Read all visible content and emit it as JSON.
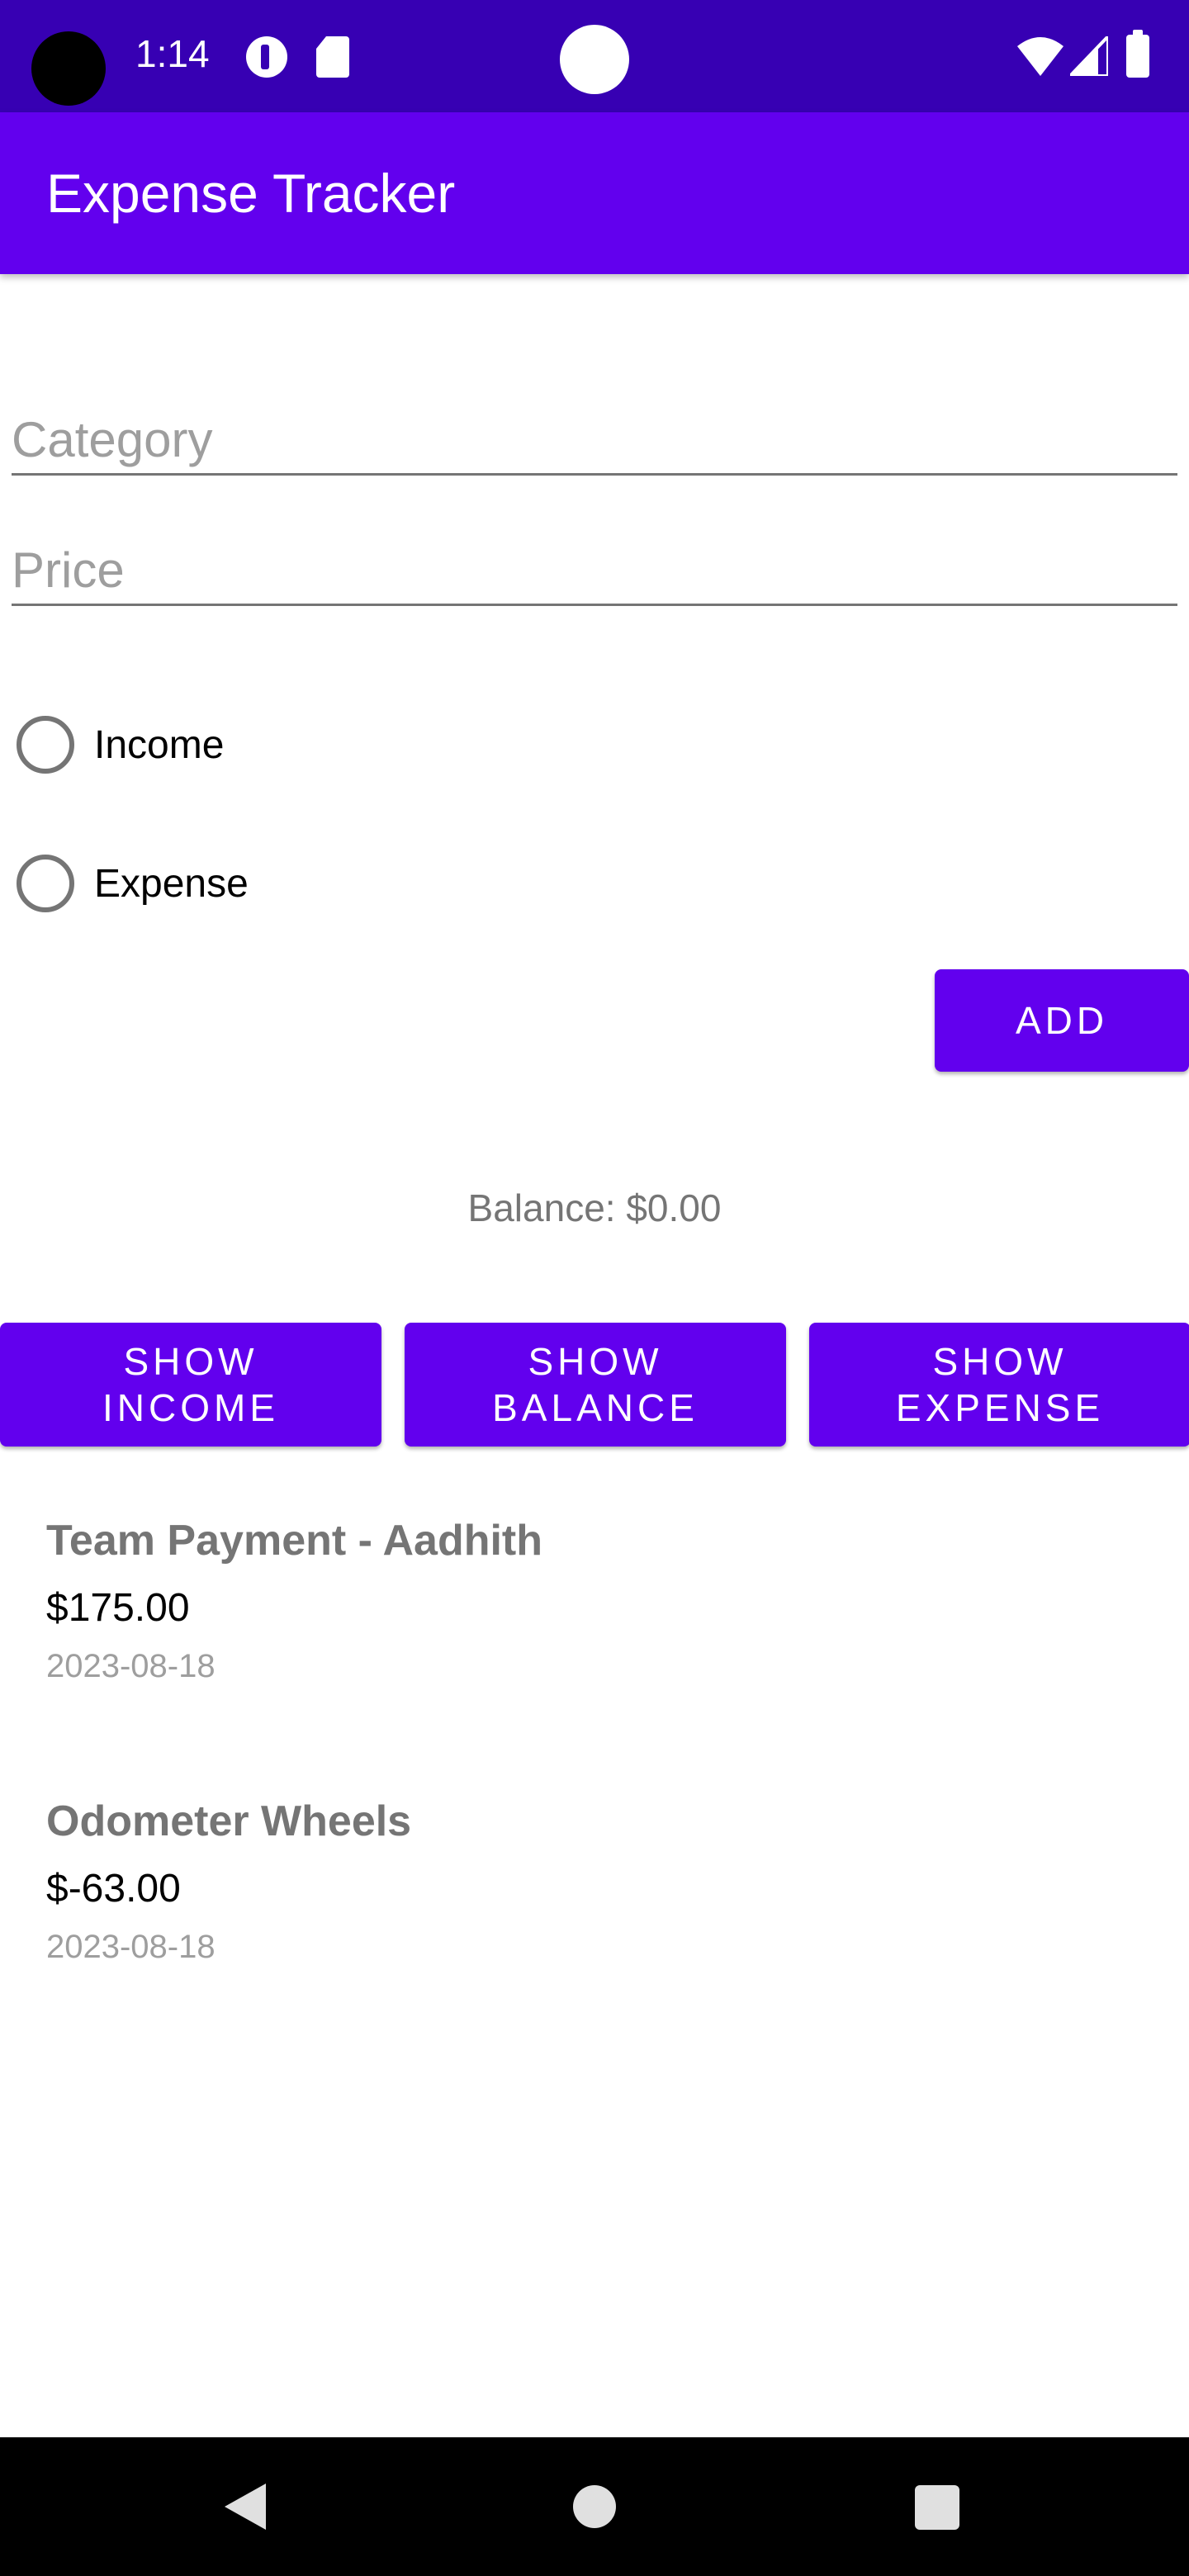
{
  "status_bar": {
    "time": "1:14",
    "icons": [
      "camera-cutout",
      "app-notification-icon",
      "sd-card-icon",
      "wifi-icon",
      "signal-icon",
      "battery-icon"
    ]
  },
  "app_bar": {
    "title": "Expense Tracker",
    "color": "#6200ee"
  },
  "form": {
    "category_placeholder": "Category",
    "category_value": "",
    "price_placeholder": "Price",
    "price_value": "",
    "radio_options": [
      {
        "label": "Income",
        "selected": false
      },
      {
        "label": "Expense",
        "selected": false
      }
    ],
    "add_label": "ADD"
  },
  "balance_text": "Balance: $0.00",
  "filter_buttons": [
    {
      "label": "SHOW\nINCOME"
    },
    {
      "label": "SHOW\nBALANCE"
    },
    {
      "label": "SHOW\nEXPENSE"
    }
  ],
  "transactions": [
    {
      "title": "Team Payment - Aadhith",
      "amount": "$175.00",
      "date": "2023-08-18"
    },
    {
      "title": "Odometer Wheels",
      "amount": "$-63.00",
      "date": "2023-08-18"
    }
  ],
  "nav_bar": {
    "icons": [
      "back-icon",
      "home-icon",
      "recents-icon"
    ]
  },
  "colors": {
    "status_bar": "#3700b3",
    "primary": "#6200ee",
    "title_gray": "#757575",
    "date_gray": "#9e9e9e"
  }
}
